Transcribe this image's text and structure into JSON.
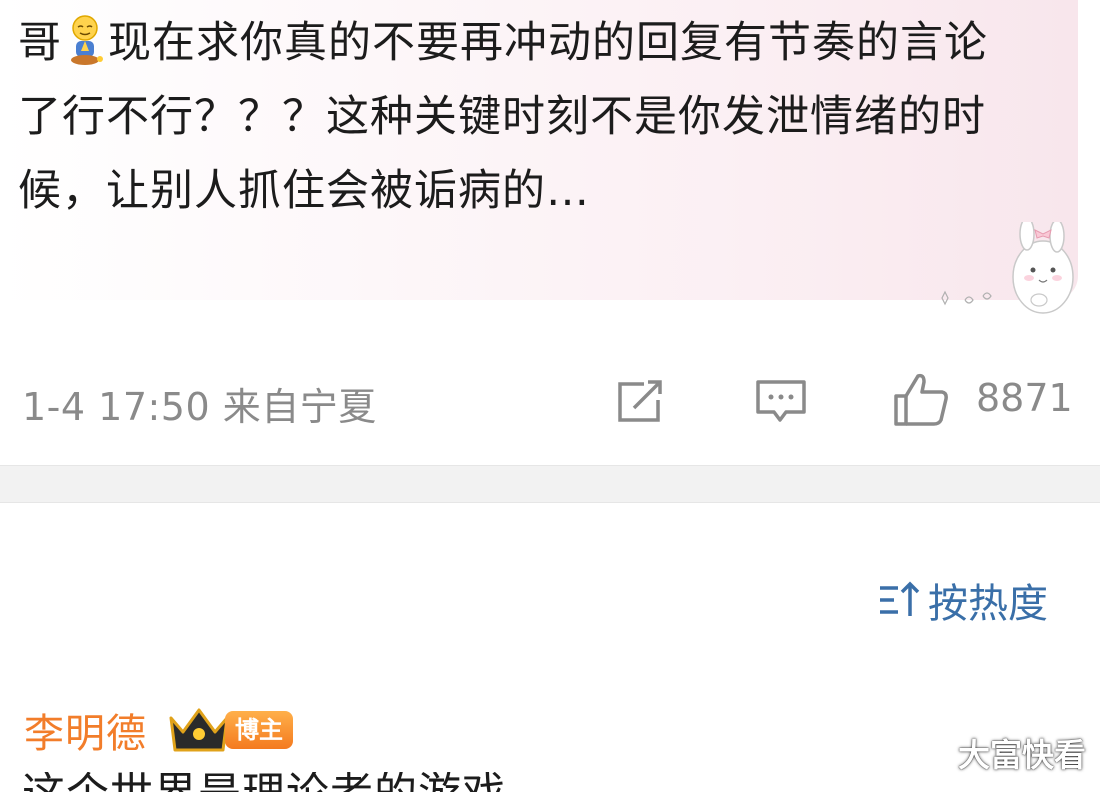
{
  "post": {
    "text_prefix": "哥",
    "text_main": "现在求你真的不要再冲动的回复有节奏的言论了行不行？？？这种关键时刻不是你发泄情绪的时候，让别人抓住会被诟病的…",
    "emoji": "praying-emoji-icon",
    "sticker": "bunny-sticker-icon",
    "meta": "1-4 17:50 来自宁夏",
    "actions": {
      "share": "share-icon",
      "comment": "comment-icon",
      "like": "like-icon",
      "like_count": "8871"
    }
  },
  "sort": {
    "label": "按热度",
    "icon": "sort-icon"
  },
  "comment": {
    "user_name": "李明德",
    "crown": "crown-icon",
    "badge": "博主",
    "text_partial": "这个世界是理论者的游戏"
  },
  "watermark": "大富快看",
  "colors": {
    "accent_blue": "#3a6fa8",
    "username_orange": "#f27d2a",
    "meta_gray": "#8a8a8a"
  }
}
